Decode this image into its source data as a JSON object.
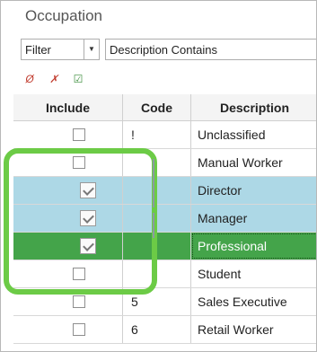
{
  "title": "Occupation",
  "filter": {
    "mode": "Filter",
    "field": "Description Contains"
  },
  "toolbar": {
    "icons": [
      "null-icon",
      "clear-icon",
      "edit-checklist-icon"
    ]
  },
  "columns": {
    "include": "Include",
    "code": "Code",
    "description": "Description"
  },
  "rows": [
    {
      "code": "!",
      "description": "Unclassified",
      "included": false,
      "state": "normal"
    },
    {
      "code": "",
      "description": "Manual Worker",
      "included": false,
      "state": "normal"
    },
    {
      "code": "",
      "description": "Director",
      "included": true,
      "state": "selected"
    },
    {
      "code": "",
      "description": "Manager",
      "included": true,
      "state": "selected"
    },
    {
      "code": "",
      "description": "Professional",
      "included": true,
      "state": "current"
    },
    {
      "code": "",
      "description": "Student",
      "included": false,
      "state": "normal"
    },
    {
      "code": "5",
      "description": "Sales Executive",
      "included": false,
      "state": "normal"
    },
    {
      "code": "6",
      "description": "Retail Worker",
      "included": false,
      "state": "normal"
    }
  ],
  "colors": {
    "selected": "#add8e6",
    "current": "#44a44a",
    "highlight": "#6ccb46"
  }
}
